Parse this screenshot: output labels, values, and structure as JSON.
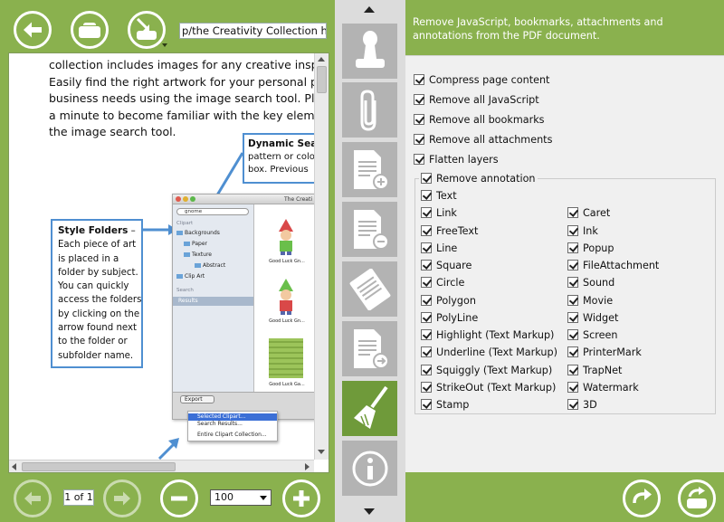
{
  "toolbar": {
    "file_path": "p/the Creativity Collection help.pdf"
  },
  "document": {
    "paragraph_lines": [
      "collection includes images for any creative inspiration",
      "Easily find the right artwork for your personal project",
      "business needs using the image search tool.  Please ta",
      "a minute to become familiar with the key elements of",
      "the image search tool."
    ],
    "callout_search": {
      "title": "Dynamic Searc",
      "line1": "pattern or colo",
      "line2": "box.  Previous"
    },
    "callout_folders": {
      "title": "Style Folders",
      "title_suffix": " –",
      "lines": [
        "Each piece of art",
        "is placed in a",
        "folder by subject.",
        "You can quickly",
        "access the folders",
        "by clicking on the",
        "arrow found next",
        "to the folder or",
        "subfolder name."
      ]
    },
    "mac_window": {
      "title": "The Creati",
      "search_text": "gnome",
      "clipart_header": "Clipart",
      "items": [
        "Backgrounds",
        "Paper",
        "Texture",
        "Abstract",
        "Clip Art"
      ],
      "search_header": "Search",
      "results_label": "Results",
      "thumb_labels": [
        "Good Luck Gn...",
        "Good Luck Gn...",
        "Good Luck Ga..."
      ],
      "export_label": "Export",
      "export_menu": [
        "Selected Clipart...",
        "Search Results...",
        "Entire Clipart Collection..."
      ]
    }
  },
  "navigation": {
    "page_indicator": "1 of 1",
    "zoom_value": "100"
  },
  "options": {
    "description": "Remove JavaScript, bookmarks, attachments and annotations from the PDF document.",
    "top_options": [
      "Compress page content",
      "Remove all JavaScript",
      "Remove all bookmarks",
      "Remove all attachments",
      "Flatten layers"
    ],
    "annotation_group_label": "Remove annotation",
    "annotations_left": [
      "Text",
      "Link",
      "FreeText",
      "Line",
      "Square",
      "Circle",
      "Polygon",
      "PolyLine",
      "Highlight (Text Markup)",
      "Underline (Text Markup)",
      "Squiggly (Text Markup)",
      "StrikeOut (Text Markup)",
      "Stamp"
    ],
    "annotations_right": [
      "Caret",
      "Ink",
      "Popup",
      "FileAttachment",
      "Sound",
      "Movie",
      "Widget",
      "Screen",
      "PrinterMark",
      "TrapNet",
      "Watermark",
      "3D"
    ]
  },
  "colors": {
    "brand_green": "#8ab14e",
    "active_tool": "#6f9a3a",
    "callout_blue": "#4f8fd1"
  }
}
